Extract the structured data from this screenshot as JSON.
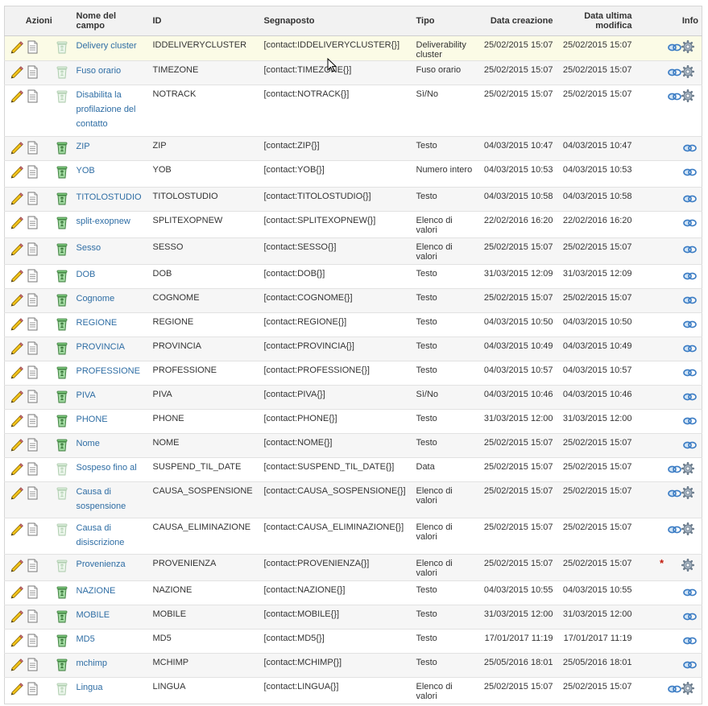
{
  "headers": {
    "azioni": "Azioni",
    "nome": "Nome del campo",
    "id": "ID",
    "segnaposto": "Segnaposto",
    "tipo": "Tipo",
    "creazione": "Data creazione",
    "modifica": "Data ultima modifica",
    "info": "Info"
  },
  "rows": [
    {
      "name": "Delivery cluster",
      "id": "IDDELIVERYCLUSTER",
      "ph": "[contact:IDDELIVERYCLUSTER{}]",
      "type": "Deliverability cluster",
      "created": "25/02/2015 15:07",
      "modified": "25/02/2015 15:07",
      "trash": "light",
      "gear": true,
      "star": false,
      "link": true,
      "h": 31,
      "hl": true
    },
    {
      "name": "Fuso orario",
      "id": "TIMEZONE",
      "ph": "[contact:TIMEZONE{}]",
      "type": "Fuso orario",
      "created": "25/02/2015 15:07",
      "modified": "25/02/2015 15:07",
      "trash": "light",
      "gear": true,
      "star": false,
      "link": true,
      "h": 30
    },
    {
      "name": "Disabilita la profilazione del contatto",
      "id": "NOTRACK",
      "ph": "[contact:NOTRACK{}]",
      "type": "Sì/No",
      "created": "25/02/2015 15:07",
      "modified": "25/02/2015 15:07",
      "trash": "light",
      "gear": true,
      "star": false,
      "link": true,
      "h": 64
    },
    {
      "name": "ZIP",
      "id": "ZIP",
      "ph": "[contact:ZIP{}]",
      "type": "Testo",
      "created": "04/03/2015 10:47",
      "modified": "04/03/2015 10:47",
      "trash": "green",
      "gear": false,
      "star": false,
      "link": true,
      "h": 30
    },
    {
      "name": "YOB",
      "id": "YOB",
      "ph": "[contact:YOB{}]",
      "type": "Numero intero",
      "created": "04/03/2015 10:53",
      "modified": "04/03/2015 10:53",
      "trash": "green",
      "gear": false,
      "star": false,
      "link": true,
      "h": 33
    },
    {
      "name": "TITOLOSTUDIO",
      "id": "TITOLOSTUDIO",
      "ph": "[contact:TITOLOSTUDIO{}]",
      "type": "Testo",
      "created": "04/03/2015 10:58",
      "modified": "04/03/2015 10:58",
      "trash": "green",
      "gear": false,
      "star": false,
      "link": true,
      "h": 30
    },
    {
      "name": "split-exopnew",
      "id": "SPLITEXOPNEW",
      "ph": "[contact:SPLITEXOPNEW{}]",
      "type": "Elenco di valori",
      "created": "22/02/2016 16:20",
      "modified": "22/02/2016 16:20",
      "trash": "green",
      "gear": false,
      "star": false,
      "link": true,
      "h": 33
    },
    {
      "name": "Sesso",
      "id": "SESSO",
      "ph": "[contact:SESSO{}]",
      "type": "Elenco di valori",
      "created": "25/02/2015 15:07",
      "modified": "25/02/2015 15:07",
      "trash": "green",
      "gear": false,
      "star": false,
      "link": true,
      "h": 33
    },
    {
      "name": "DOB",
      "id": "DOB",
      "ph": "[contact:DOB{}]",
      "type": "Testo",
      "created": "31/03/2015 12:09",
      "modified": "31/03/2015 12:09",
      "trash": "green",
      "gear": false,
      "star": false,
      "link": true,
      "h": 30
    },
    {
      "name": "Cognome",
      "id": "COGNOME",
      "ph": "[contact:COGNOME{}]",
      "type": "Testo",
      "created": "25/02/2015 15:07",
      "modified": "25/02/2015 15:07",
      "trash": "green",
      "gear": false,
      "star": false,
      "link": true,
      "h": 30
    },
    {
      "name": "REGIONE",
      "id": "REGIONE",
      "ph": "[contact:REGIONE{}]",
      "type": "Testo",
      "created": "04/03/2015 10:50",
      "modified": "04/03/2015 10:50",
      "trash": "green",
      "gear": false,
      "star": false,
      "link": true,
      "h": 30
    },
    {
      "name": "PROVINCIA",
      "id": "PROVINCIA",
      "ph": "[contact:PROVINCIA{}]",
      "type": "Testo",
      "created": "04/03/2015 10:49",
      "modified": "04/03/2015 10:49",
      "trash": "green",
      "gear": false,
      "star": false,
      "link": true,
      "h": 30
    },
    {
      "name": "PROFESSIONE",
      "id": "PROFESSIONE",
      "ph": "[contact:PROFESSIONE{}]",
      "type": "Testo",
      "created": "04/03/2015 10:57",
      "modified": "04/03/2015 10:57",
      "trash": "green",
      "gear": false,
      "star": false,
      "link": true,
      "h": 30
    },
    {
      "name": "PIVA",
      "id": "PIVA",
      "ph": "[contact:PIVA{}]",
      "type": "Sì/No",
      "created": "04/03/2015 10:46",
      "modified": "04/03/2015 10:46",
      "trash": "green",
      "gear": false,
      "star": false,
      "link": true,
      "h": 30
    },
    {
      "name": "PHONE",
      "id": "PHONE",
      "ph": "[contact:PHONE{}]",
      "type": "Testo",
      "created": "31/03/2015 12:00",
      "modified": "31/03/2015 12:00",
      "trash": "green",
      "gear": false,
      "star": false,
      "link": true,
      "h": 30
    },
    {
      "name": "Nome",
      "id": "NOME",
      "ph": "[contact:NOME{}]",
      "type": "Testo",
      "created": "25/02/2015 15:07",
      "modified": "25/02/2015 15:07",
      "trash": "green",
      "gear": false,
      "star": false,
      "link": true,
      "h": 30
    },
    {
      "name": "Sospeso fino al",
      "id": "SUSPEND_TIL_DATE",
      "ph": "[contact:SUSPEND_TIL_DATE{}]",
      "type": "Data",
      "created": "25/02/2015 15:07",
      "modified": "25/02/2015 15:07",
      "trash": "light",
      "gear": true,
      "star": false,
      "link": true,
      "h": 30
    },
    {
      "name": "Causa di sospensione",
      "id": "CAUSA_SOSPENSIONE",
      "ph": "[contact:CAUSA_SOSPENSIONE{}]",
      "type": "Elenco di valori",
      "created": "25/02/2015 15:07",
      "modified": "25/02/2015 15:07",
      "trash": "light",
      "gear": true,
      "star": false,
      "link": true,
      "h": 45
    },
    {
      "name": "Causa di disiscrizione",
      "id": "CAUSA_ELIMINAZIONE",
      "ph": "[contact:CAUSA_ELIMINAZIONE{}]",
      "type": "Elenco di valori",
      "created": "25/02/2015 15:07",
      "modified": "25/02/2015 15:07",
      "trash": "light",
      "gear": true,
      "star": false,
      "link": true,
      "h": 45
    },
    {
      "name": "Provenienza",
      "id": "PROVENIENZA",
      "ph": "[contact:PROVENIENZA{}]",
      "type": "Elenco di valori",
      "created": "25/02/2015 15:07",
      "modified": "25/02/2015 15:07",
      "trash": "light",
      "gear": true,
      "star": true,
      "link": false,
      "h": 33
    },
    {
      "name": "NAZIONE",
      "id": "NAZIONE",
      "ph": "[contact:NAZIONE{}]",
      "type": "Testo",
      "created": "04/03/2015 10:55",
      "modified": "04/03/2015 10:55",
      "trash": "green",
      "gear": false,
      "star": false,
      "link": true,
      "h": 30
    },
    {
      "name": "MOBILE",
      "id": "MOBILE",
      "ph": "[contact:MOBILE{}]",
      "type": "Testo",
      "created": "31/03/2015 12:00",
      "modified": "31/03/2015 12:00",
      "trash": "green",
      "gear": false,
      "star": false,
      "link": true,
      "h": 30
    },
    {
      "name": "MD5",
      "id": "MD5",
      "ph": "[contact:MD5{}]",
      "type": "Testo",
      "created": "17/01/2017 11:19",
      "modified": "17/01/2017 11:19",
      "trash": "green",
      "gear": false,
      "star": false,
      "link": true,
      "h": 30
    },
    {
      "name": "mchimp",
      "id": "MCHIMP",
      "ph": "[contact:MCHIMP{}]",
      "type": "Testo",
      "created": "25/05/2016 18:01",
      "modified": "25/05/2016 18:01",
      "trash": "green",
      "gear": false,
      "star": false,
      "link": true,
      "h": 30
    },
    {
      "name": "Lingua",
      "id": "LINGUA",
      "ph": "[contact:LINGUA{}]",
      "type": "Elenco di valori",
      "created": "25/02/2015 15:07",
      "modified": "25/02/2015 15:07",
      "trash": "light",
      "gear": true,
      "star": false,
      "link": true,
      "h": 33
    }
  ],
  "colors": {
    "link": "#2e6da4",
    "header_bg": "#f2f2f2",
    "row_alt": "#f6f6f6",
    "row_highlight": "#fbfbe6",
    "star": "#c21807"
  },
  "icons": [
    "edit-pencil-icon",
    "document-icon",
    "trash-icon",
    "link-chain-icon",
    "gear-icon",
    "required-star-icon"
  ],
  "star_glyph": "*"
}
